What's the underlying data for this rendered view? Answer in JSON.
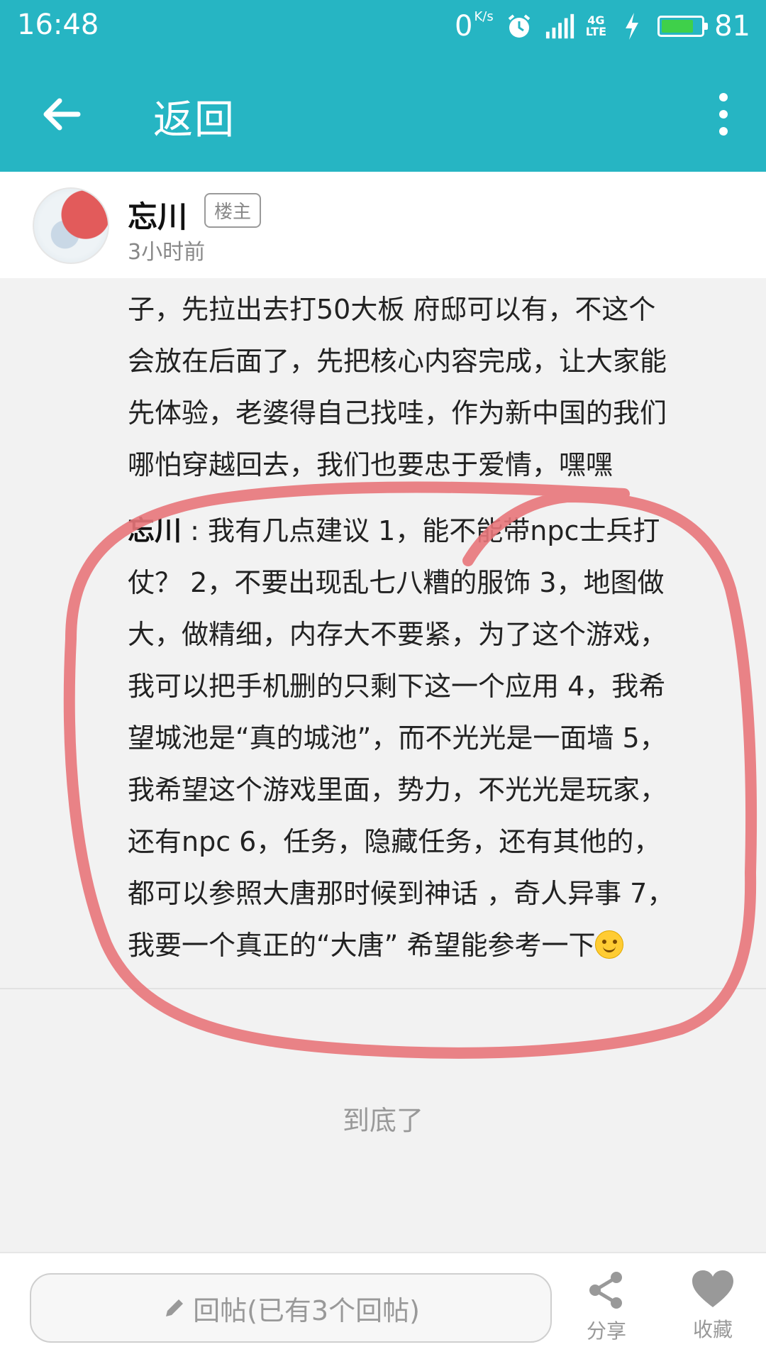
{
  "status_bar": {
    "time": "16:48",
    "speed_value": "0",
    "speed_unit": "K/s",
    "network": "4G",
    "network_sub": "LTE",
    "battery_level": 81,
    "battery_text": "81"
  },
  "app_bar": {
    "title": "返回"
  },
  "author": {
    "name": "忘川",
    "badge": "楼主",
    "time": "3小时前"
  },
  "post": {
    "lines": [
      "子，先拉出去打50大板 府邸可以有，不这个",
      "会放在后面了，先把核心内容完成，让大家能",
      "先体验，老婆得自己找哇，作为新中国的我们",
      "哪怕穿越回去，我们也要忠于爱情，嘿嘿"
    ]
  },
  "reply": {
    "name": "忘川",
    "separator": " : ",
    "lines": [
      "我有几点建议 1，能不能带npc士兵打",
      "仗？ 2，不要出现乱七八糟的服饰 3，地图做",
      "大，做精细，内存大不要紧，为了这个游戏，",
      "我可以把手机删的只剩下这一个应用 4，我希",
      "望城池是“真的城池”，而不光光是一面墙 5，",
      "我希望这个游戏里面，势力，不光光是玩家，",
      "还有npc 6，任务，隐藏任务，还有其他的，",
      "都可以参照大唐那时候到神话 ，奇人异事 7，",
      "我要一个真正的“大唐” 希望能参考一下"
    ],
    "emoji": "smile-emoji"
  },
  "footer": {
    "end_text": "到底了",
    "reply_placeholder": "回帖(已有3个回帖)",
    "share_label": "分享",
    "favorite_label": "收藏"
  },
  "colors": {
    "accent": "#26b5c3",
    "annotation": "#e8767a"
  }
}
